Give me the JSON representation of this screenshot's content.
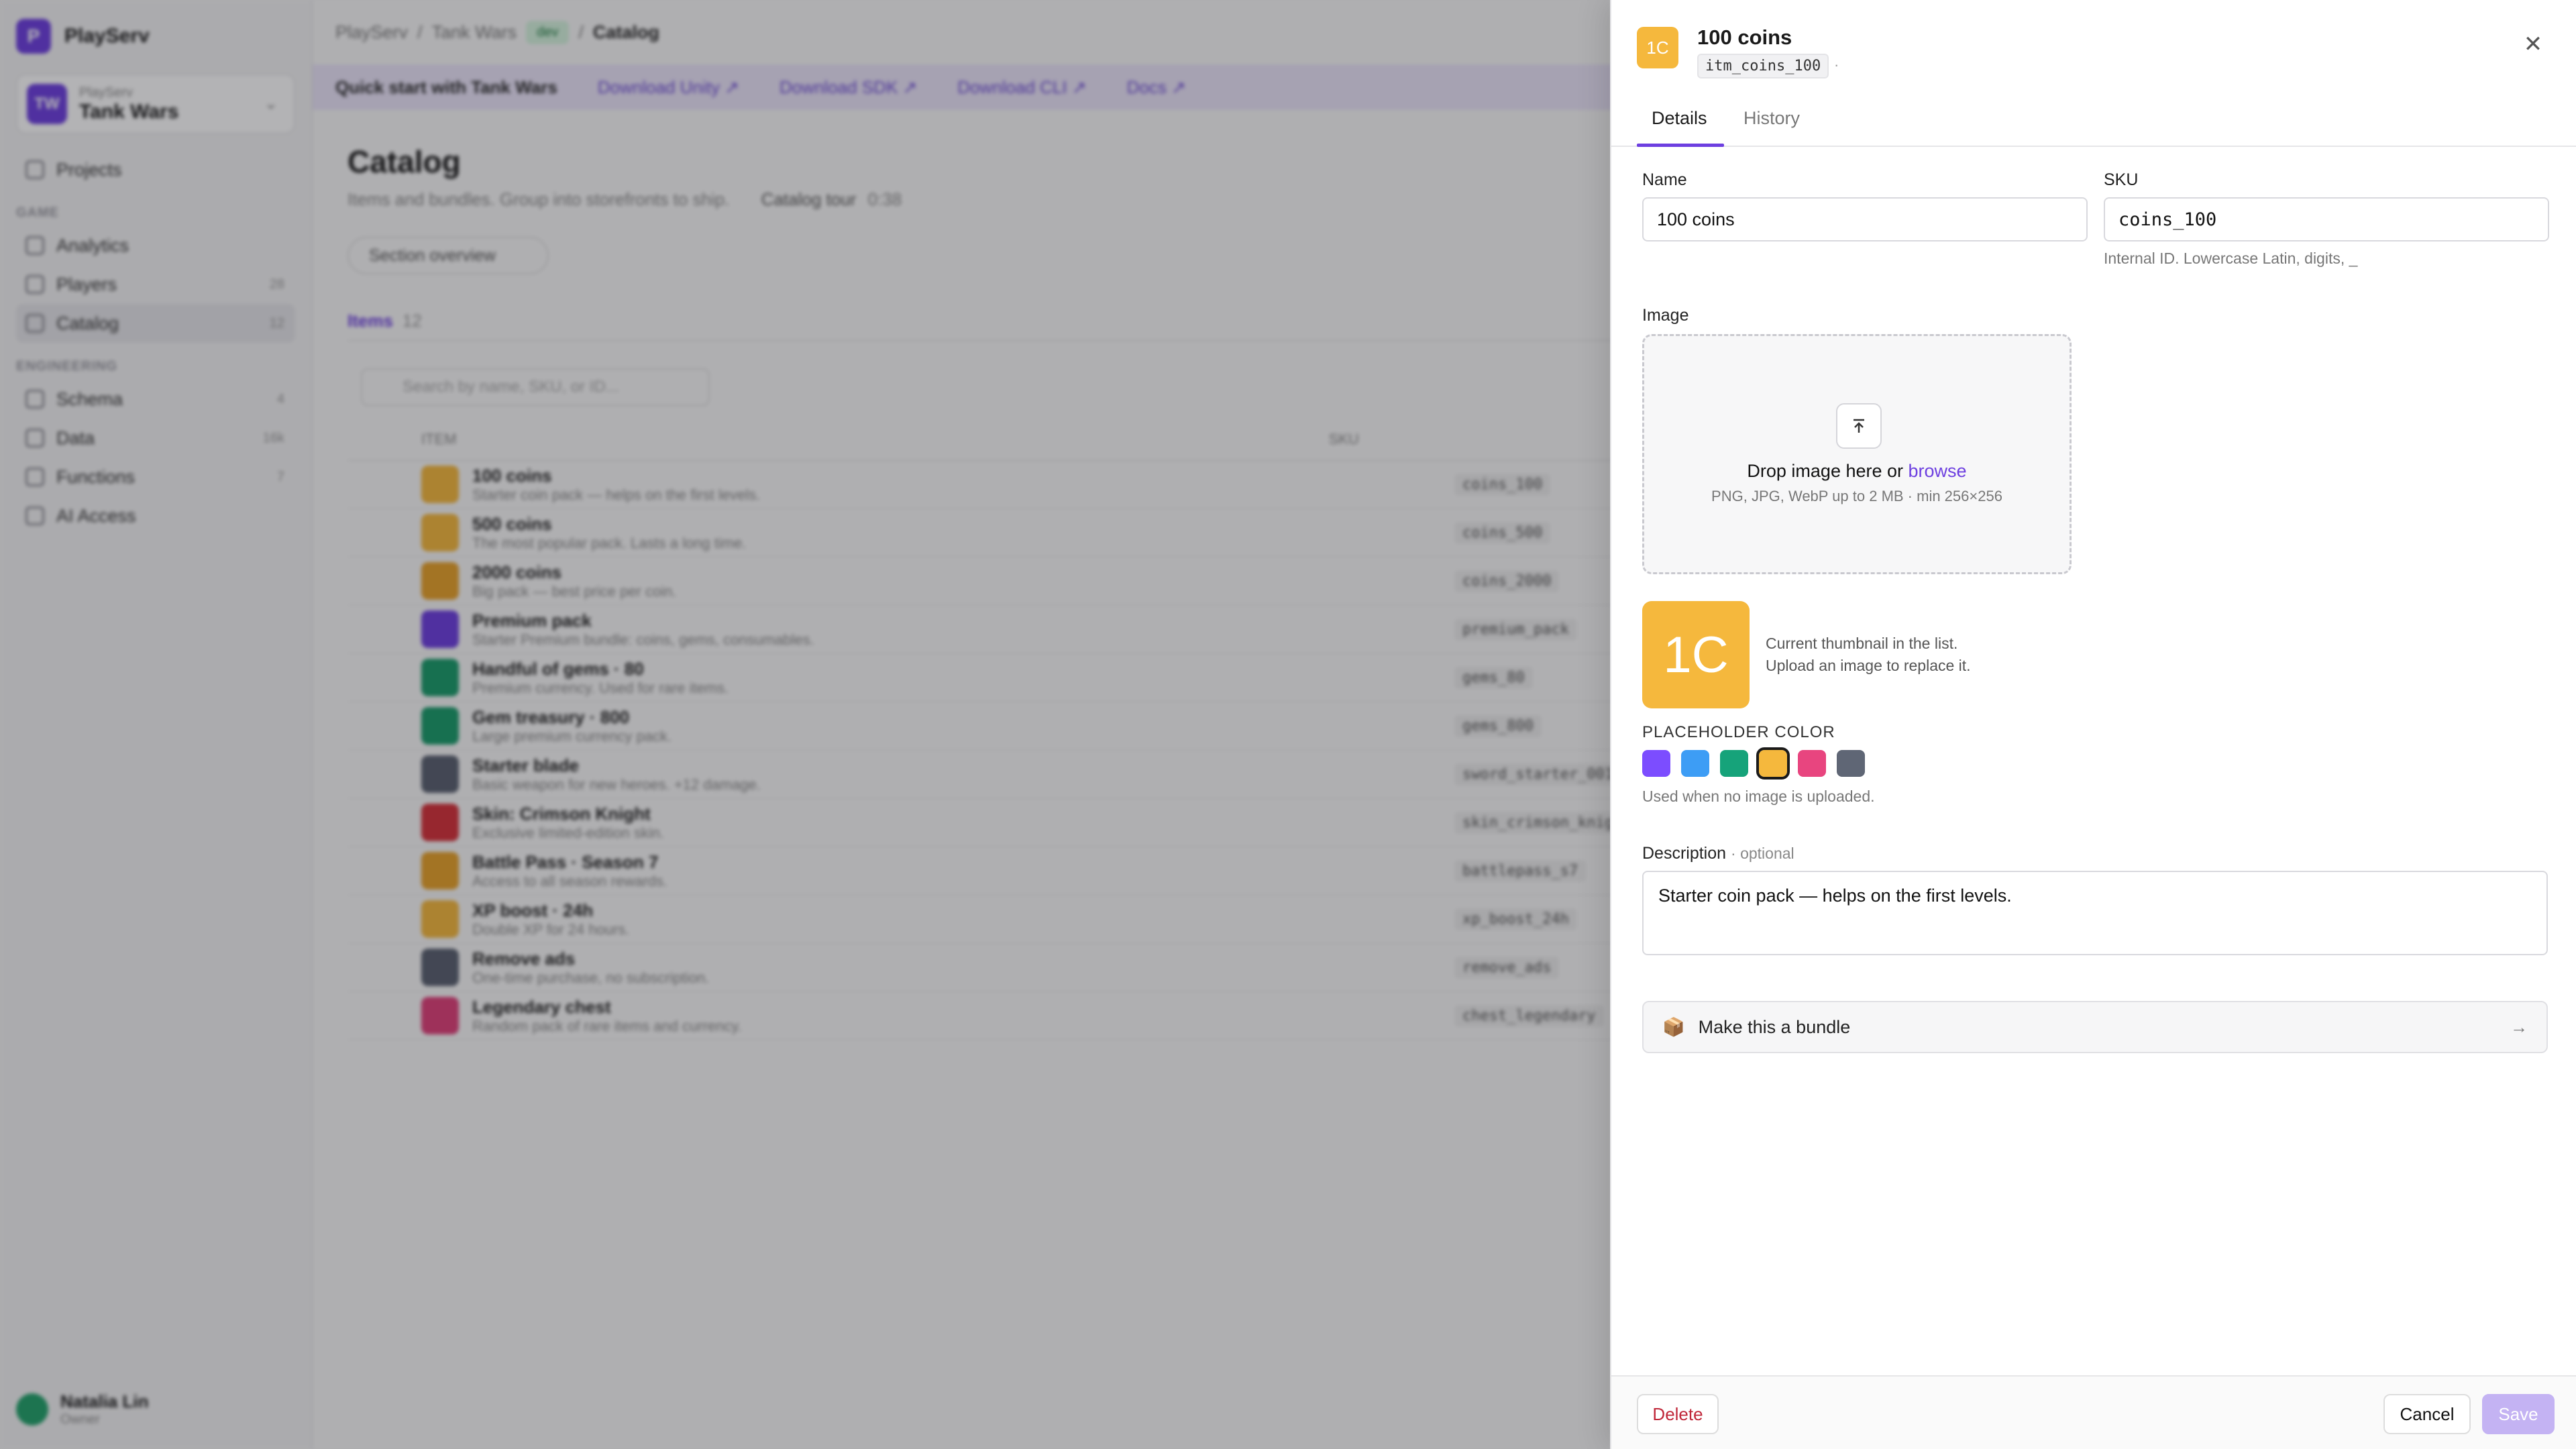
{
  "sidebar": {
    "brand": "PlayServ",
    "brand_initial": "P",
    "project_org": "PlayServ",
    "project_name": "Tank Wars",
    "project_initials": "TW",
    "items": [
      {
        "label": "Projects",
        "count": ""
      },
      {
        "section": "GAME"
      },
      {
        "label": "Analytics",
        "count": ""
      },
      {
        "label": "Players",
        "count": "28"
      },
      {
        "label": "Catalog",
        "count": "12"
      },
      {
        "section": "ENGINEERING"
      },
      {
        "label": "Schema",
        "count": "4"
      },
      {
        "label": "Data",
        "count": "16k"
      },
      {
        "label": "Functions",
        "count": "7"
      },
      {
        "label": "AI Access",
        "count": ""
      }
    ],
    "user_name": "Natalia Lin",
    "user_role": "Owner"
  },
  "breadcrumb": {
    "org": "PlayServ",
    "project": "Tank Wars",
    "env": "dev",
    "page": "Catalog"
  },
  "quickstart": {
    "title": "Quick start with Tank Wars",
    "links": [
      "Download Unity ↗",
      "Download SDK ↗",
      "Download CLI ↗",
      "Docs ↗"
    ]
  },
  "catalog": {
    "title": "Catalog",
    "subtitle": "Items and bundles. Group into storefronts to ship.",
    "tour": "Catalog tour",
    "tour_time": "0:38",
    "section_overview": "Section overview",
    "tab_items": "Items",
    "tab_items_count": "12",
    "search_placeholder": "Search by name, SKU, or ID...",
    "col_item": "ITEM",
    "col_sku": "SKU",
    "rows": [
      {
        "title": "100 coins",
        "desc": "Starter coin pack — helps on the first levels.",
        "sku": "coins_100",
        "color": "#f5b83d"
      },
      {
        "title": "500 coins",
        "desc": "The most popular pack. Lasts a long time.",
        "sku": "coins_500",
        "color": "#f5b83d"
      },
      {
        "title": "2000 coins",
        "desc": "Big pack — best price per coin.",
        "sku": "coins_2000",
        "color": "#e8a22a"
      },
      {
        "title": "Premium pack",
        "desc": "Starter Premium bundle: coins, gems, consumables.",
        "sku": "premium_pack",
        "color": "#6d3fe0"
      },
      {
        "title": "Handful of gems · 80",
        "desc": "Premium currency. Used for rare items.",
        "sku": "gems_80",
        "color": "#1a9c6b"
      },
      {
        "title": "Gem treasury · 800",
        "desc": "Large premium currency pack.",
        "sku": "gems_800",
        "color": "#1a9c6b"
      },
      {
        "title": "Starter blade",
        "desc": "Basic weapon for new heroes. +12 damage.",
        "sku": "sword_starter_001",
        "color": "#5a6170"
      },
      {
        "title": "Skin: Crimson Knight",
        "desc": "Exclusive limited-edition skin.",
        "sku": "skin_crimson_knight",
        "color": "#d6323a"
      },
      {
        "title": "Battle Pass · Season 7",
        "desc": "Access to all season rewards.",
        "sku": "battlepass_s7",
        "color": "#e8a22a"
      },
      {
        "title": "XP boost · 24h",
        "desc": "Double XP for 24 hours.",
        "sku": "xp_boost_24h",
        "color": "#f5b83d"
      },
      {
        "title": "Remove ads",
        "desc": "One-time purchase, no subscription.",
        "sku": "remove_ads",
        "color": "#5a6170"
      },
      {
        "title": "Legendary chest",
        "desc": "Random pack of rare items and currency.",
        "sku": "chest_legendary",
        "color": "#e0407a"
      }
    ]
  },
  "drawer": {
    "thumb_initials": "1C",
    "title": "100 coins",
    "item_id": "itm_coins_100",
    "id_suffix": "·",
    "tabs": [
      "Details",
      "History"
    ],
    "name_label": "Name",
    "name_value": "100 coins",
    "sku_label": "SKU",
    "sku_value": "coins_100",
    "sku_hint": "Internal ID. Lowercase Latin, digits, _",
    "image_label": "Image",
    "drop_text": "Drop image here or ",
    "drop_link": "browse",
    "drop_sub": "PNG, JPG, WebP up to 2 MB · min 256×256",
    "thumb_note_1": "Current thumbnail in the list.",
    "thumb_note_2": "Upload an image to replace it.",
    "placeholder_label": "PLACEHOLDER COLOR",
    "swatch_colors": [
      "#7c4dff",
      "#3d9df5",
      "#16a37a",
      "#f5b83d",
      "#e8457f",
      "#5f6675"
    ],
    "selected_swatch": 3,
    "placeholder_hint": "Used when no image is uploaded.",
    "description_label": "Description",
    "description_optional": "· optional",
    "description_value": "Starter coin pack — helps on the first levels.",
    "bundle_label": "Make this a bundle",
    "delete_label": "Delete",
    "cancel_label": "Cancel",
    "save_label": "Save"
  }
}
